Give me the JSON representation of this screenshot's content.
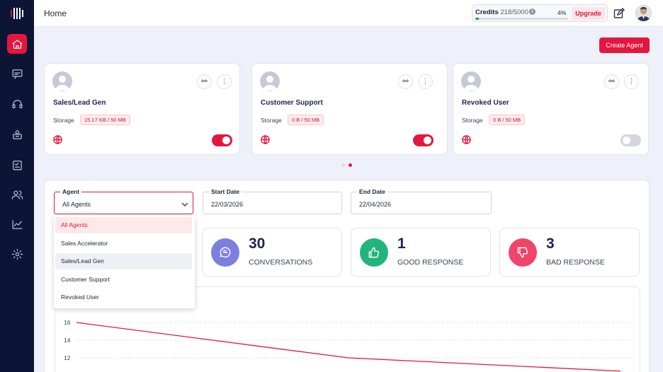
{
  "header": {
    "title": "Home",
    "credits_label": "Credits",
    "credits_value": "218/5000",
    "credits_percent_label": "4%",
    "credits_fraction": 0.04,
    "upgrade_label": "Upgrade"
  },
  "sidebar": {
    "items": [
      {
        "name": "home-icon",
        "active": true
      },
      {
        "name": "chat-icon",
        "active": false
      },
      {
        "name": "headset-icon",
        "active": false
      },
      {
        "name": "agent-icon",
        "active": false
      },
      {
        "name": "tasks-icon",
        "active": false
      },
      {
        "name": "users-icon",
        "active": false
      },
      {
        "name": "analytics-icon",
        "active": false
      },
      {
        "name": "settings-icon",
        "active": false
      }
    ]
  },
  "create_agent_label": "Create Agent",
  "agents": [
    {
      "name": "Sales/Lead Gen",
      "storage_label": "Storage",
      "storage": "15.17 KB / 50 MB",
      "enabled": true
    },
    {
      "name": "Customer Support",
      "storage_label": "Storage",
      "storage": "0 B / 50 MB",
      "enabled": true
    },
    {
      "name": "Revoked User",
      "storage_label": "Storage",
      "storage": "0 B / 50 MB",
      "enabled": false
    }
  ],
  "filters": {
    "agent_label": "Agent",
    "agent_value": "All Agents",
    "start_label": "Start Date",
    "start_value": "22/03/2026",
    "end_label": "End Date",
    "end_value": "22/04/2026"
  },
  "dropdown": {
    "options": [
      "All Agents",
      "Sales Accelerator",
      "Sales/Lead Gen",
      "Customer Support",
      "Revoked User"
    ],
    "selected": "All Agents"
  },
  "stats": [
    {
      "value": "30",
      "label": "CONVERSATIONS",
      "color": "#7b7fe0"
    },
    {
      "value": "1",
      "label": "GOOD RESPONSE",
      "color": "#23b47e"
    },
    {
      "value": "3",
      "label": "BAD RESPONSE",
      "color": "#f1446a"
    }
  ],
  "chart_data": {
    "type": "line",
    "y_ticks": [
      "16",
      "14",
      "12"
    ],
    "x": [
      0,
      1,
      2
    ],
    "values": [
      16,
      12,
      10.5
    ],
    "ylim": [
      10,
      17
    ],
    "grid": true,
    "color": "#e3173e"
  },
  "colors": {
    "accent": "#e3173e",
    "sidebar": "#0c1536"
  }
}
